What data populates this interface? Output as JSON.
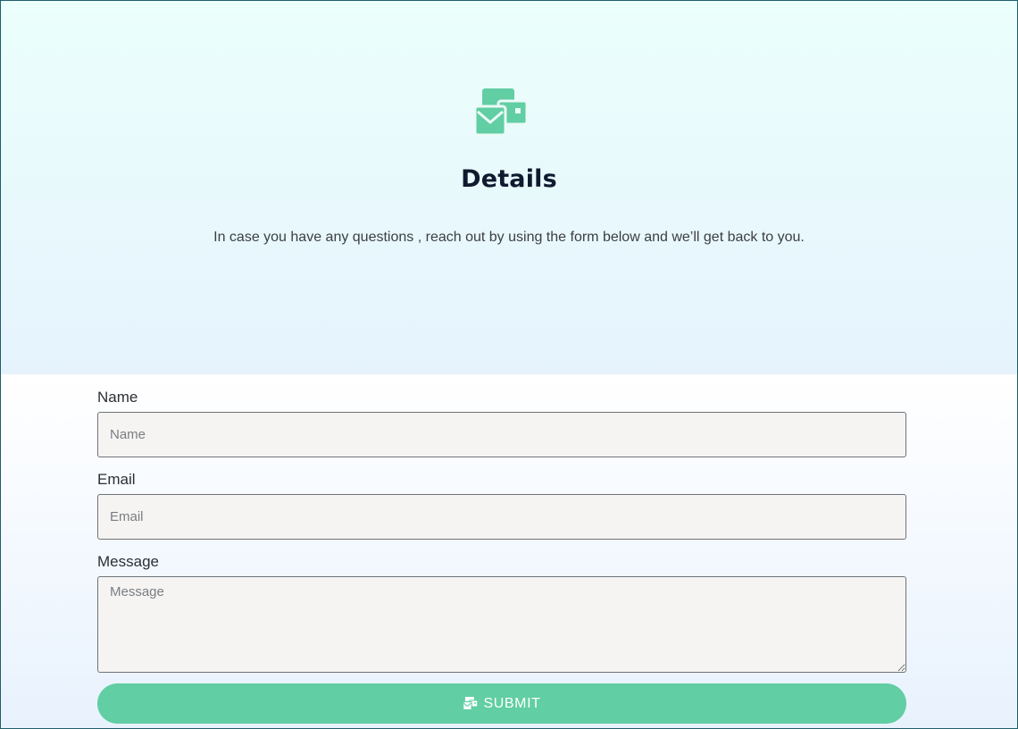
{
  "colors": {
    "accent": "#61cea3",
    "title_text": "#0f1a2e",
    "border": "#1f5f6b"
  },
  "header": {
    "icon": "envelope-card-icon",
    "title": "Details",
    "subtitle": "In case you have any questions , reach out by using the form below and we’ll get back to you."
  },
  "form": {
    "name": {
      "label": "Name",
      "placeholder": "Name",
      "value": ""
    },
    "email": {
      "label": "Email",
      "placeholder": "Email",
      "value": ""
    },
    "message": {
      "label": "Message",
      "placeholder": "Message",
      "value": ""
    },
    "submit": {
      "label": "SUBMIT",
      "icon": "envelope-card-icon"
    }
  }
}
